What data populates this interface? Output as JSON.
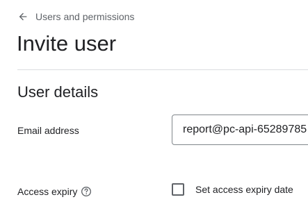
{
  "breadcrumb": {
    "back_icon": "arrow-back-icon",
    "label": "Users and permissions"
  },
  "page": {
    "title": "Invite user"
  },
  "section": {
    "title": "User details"
  },
  "email": {
    "label": "Email address",
    "value": "report@pc-api-65289785"
  },
  "access_expiry": {
    "label": "Access expiry",
    "help_icon": "help-circle-icon",
    "checkbox_label": "Set access expiry date",
    "checked": false
  },
  "colors": {
    "text_primary": "#202124",
    "text_secondary": "#5f6368",
    "divider": "#dadce0",
    "input_border": "#80868b"
  }
}
